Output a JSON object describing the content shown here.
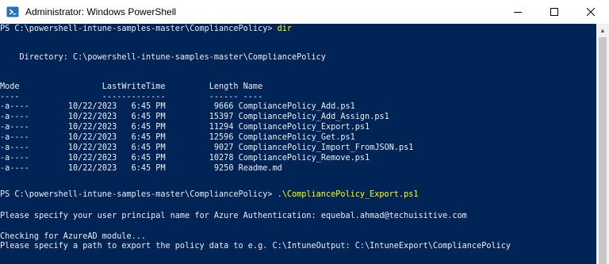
{
  "window": {
    "title": "Administrator: Windows PowerShell",
    "icons": {
      "app": "powershell-icon",
      "minimize": "minimize-icon",
      "maximize": "maximize-icon",
      "close": "close-icon"
    },
    "colors": {
      "background": "#012456",
      "text": "#eeedf0",
      "command": "#ffff00",
      "titlebar": "#ffffff"
    }
  },
  "console": {
    "prompt1": "PS C:\\powershell-intune-samples-master\\CompliancePolicy> ",
    "cmd1": "dir",
    "directory_line": "    Directory: C:\\powershell-intune-samples-master\\CompliancePolicy",
    "header_line": "Mode                 LastWriteTime         Length Name",
    "underline_line": "----                 -------------         ------ ----",
    "files": [
      {
        "mode": "-a----",
        "date": "10/22/2023",
        "time": "6:45 PM",
        "length": "9666",
        "name": "CompliancePolicy_Add.ps1"
      },
      {
        "mode": "-a----",
        "date": "10/22/2023",
        "time": "6:45 PM",
        "length": "15397",
        "name": "CompliancePolicy_Add_Assign.ps1"
      },
      {
        "mode": "-a----",
        "date": "10/22/2023",
        "time": "6:45 PM",
        "length": "11294",
        "name": "CompliancePolicy_Export.ps1"
      },
      {
        "mode": "-a----",
        "date": "10/22/2023",
        "time": "6:45 PM",
        "length": "12596",
        "name": "CompliancePolicy_Get.ps1"
      },
      {
        "mode": "-a----",
        "date": "10/22/2023",
        "time": "6:45 PM",
        "length": "9027",
        "name": "CompliancePolicy_Import_FromJSON.ps1"
      },
      {
        "mode": "-a----",
        "date": "10/22/2023",
        "time": "6:45 PM",
        "length": "10278",
        "name": "CompliancePolicy_Remove.ps1"
      },
      {
        "mode": "-a----",
        "date": "10/22/2023",
        "time": "6:45 PM",
        "length": "9250",
        "name": "Readme.md"
      }
    ],
    "prompt2": "PS C:\\powershell-intune-samples-master\\CompliancePolicy> ",
    "cmd2": ".\\CompliancePolicy_Export.ps1",
    "upn_line": "Please specify your user principal name for Azure Authentication: equebal.ahmad@techuisitive.com",
    "check_line": "Checking for AzureAD module...",
    "path_line": "Please specify a path to export the policy data to e.g. C:\\IntuneOutput: C:\\IntuneExport\\CompliancePolicy"
  }
}
